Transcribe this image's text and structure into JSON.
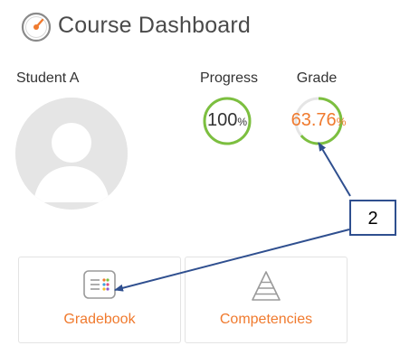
{
  "header": {
    "title": "Course Dashboard",
    "icon": "gauge-icon"
  },
  "student": {
    "name": "Student A",
    "avatar_icon": "user-avatar-icon"
  },
  "metrics": {
    "progress": {
      "label": "Progress",
      "value": "100",
      "unit": "%",
      "fraction": 1.0,
      "color": "#7cbf3f"
    },
    "grade": {
      "label": "Grade",
      "value": "63.76",
      "unit": "%",
      "fraction": 0.6376,
      "color": "#7cbf3f",
      "value_color": "#f07a2e"
    }
  },
  "cards": [
    {
      "label": "Gradebook",
      "icon": "gradebook-icon"
    },
    {
      "label": "Competencies",
      "icon": "pyramid-icon"
    }
  ],
  "callout": {
    "label": "2",
    "color": "#2f4f8f"
  },
  "colors": {
    "accent": "#f07a2e",
    "ring": "#7cbf3f",
    "callout": "#2f4f8f"
  }
}
